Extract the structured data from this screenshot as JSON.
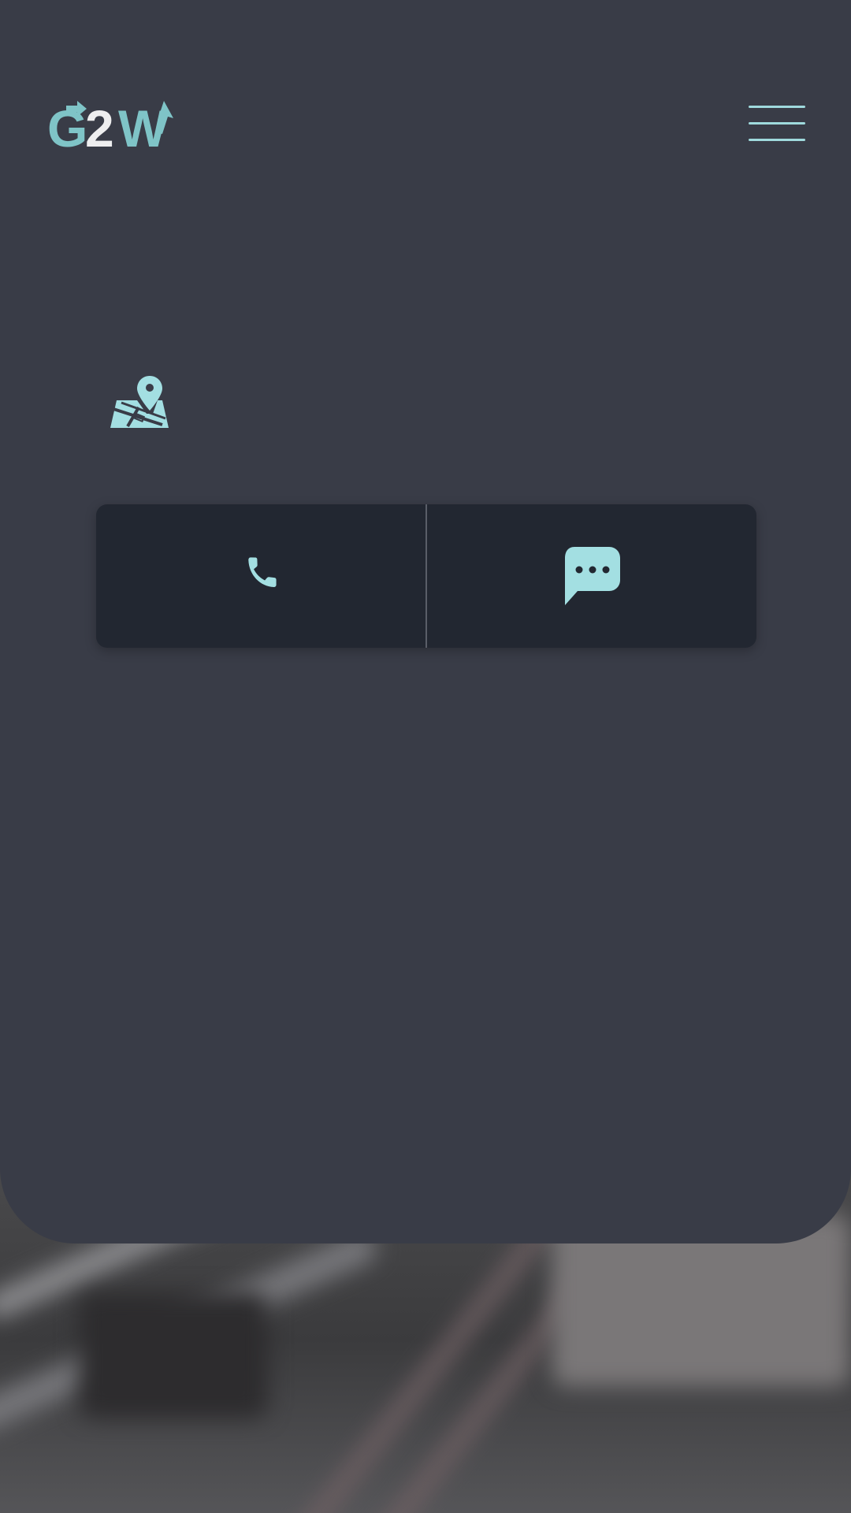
{
  "brand": {
    "logo_text": "G2W",
    "logo_part1": "G",
    "logo_part2": "2",
    "logo_part3": "W",
    "accent_color": "#7fc4c7",
    "icon_color": "#a3dfe2",
    "card_color": "#393c47",
    "bar_color": "#222731"
  },
  "header": {
    "menu_icon": "hamburger-menu-icon"
  },
  "location": {
    "icon": "map-location-icon"
  },
  "contact": {
    "call_icon": "phone-icon",
    "message_icon": "chat-bubble-icon"
  },
  "background": {
    "image": "blurred-road-photo"
  }
}
